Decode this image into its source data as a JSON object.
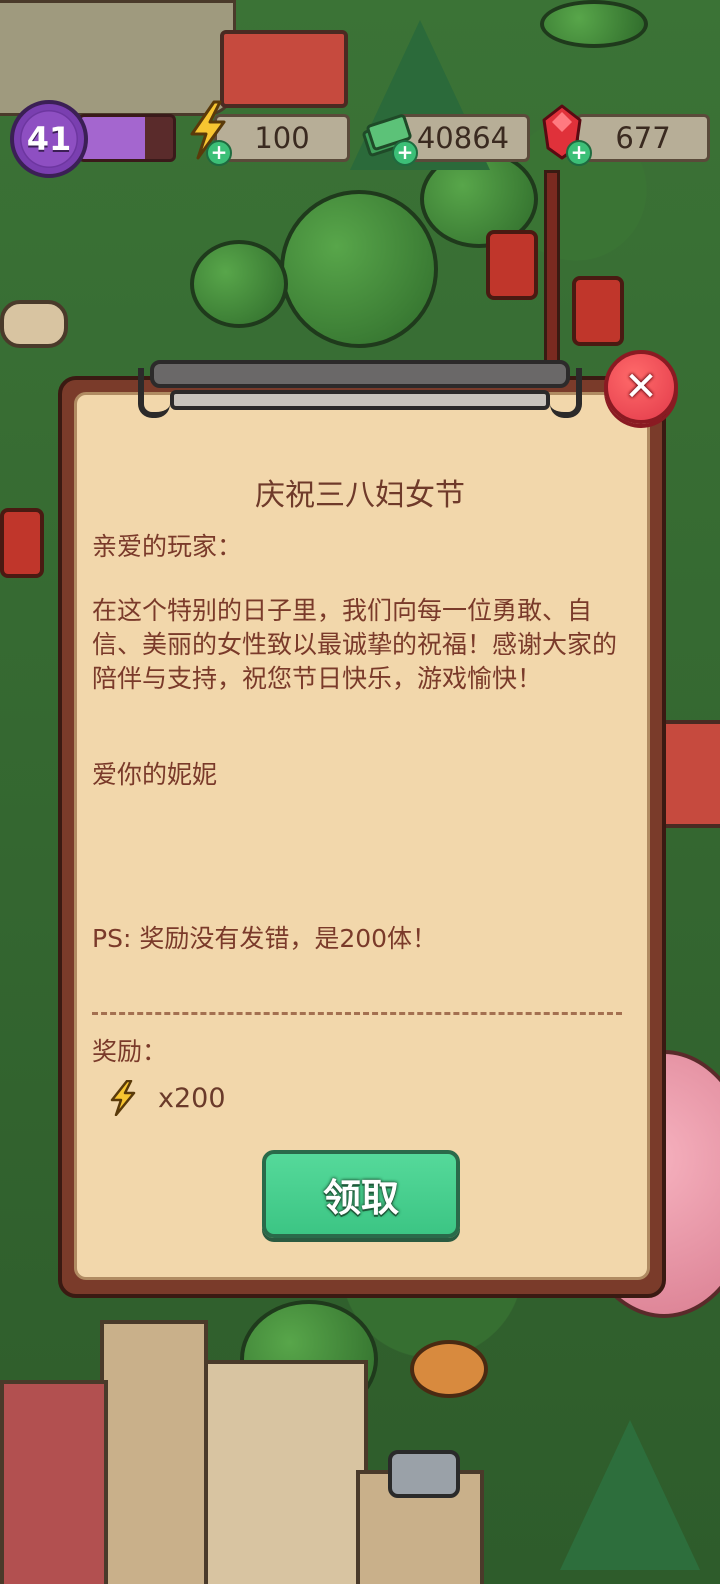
{
  "hud": {
    "level": "41",
    "xp_progress": 0.7,
    "energy": "100",
    "cash": "40864",
    "gems": "677",
    "icons": {
      "level": "purple-flower-badge-icon",
      "energy": "lightning-bolt-icon",
      "cash": "cash-stack-icon",
      "gems": "red-gem-icon",
      "add": "plus-icon"
    }
  },
  "dialog": {
    "title": "庆祝三八妇女节",
    "salutation": "亲爱的玩家：",
    "paragraph": "在这个特别的日子里，我们向每一位勇敢、自信、美丽的女性致以最诚挚的祝福！感谢大家的陪伴与支持，祝您节日快乐，游戏愉快！",
    "signature": "爱你的妮妮",
    "ps": "PS: 奖励没有发错，是200体！",
    "reward_label": "奖励：",
    "reward_count": "x200",
    "reward_icon": "lightning-bolt-icon",
    "claim_label": "领取",
    "close_icon": "close-icon"
  },
  "colors": {
    "claim_button": "#3cc584",
    "close_button": "#e23a4a",
    "paper": "#f2d7ab",
    "text": "#7a3a2a"
  }
}
